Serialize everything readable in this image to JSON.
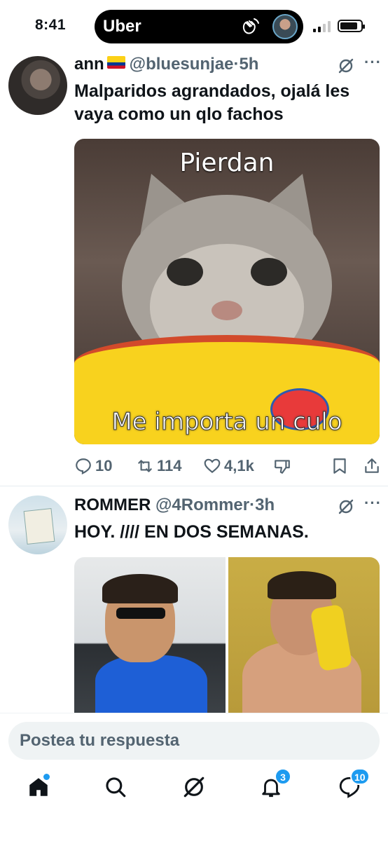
{
  "status_bar": {
    "time": "8:41",
    "island_app": "Uber",
    "icons": [
      "wave-hand-icon",
      "avatar",
      "signal-icon",
      "battery-icon"
    ]
  },
  "tweets": [
    {
      "name": "ann",
      "flag": "colombia-flag-icon",
      "handle": "@bluesunjae",
      "age": "5h",
      "text": "Malparidos agrandados, ojalá les vaya como un qlo fachos",
      "media_caption_top": "Pierdan",
      "media_caption_bottom": "Me importa un culo",
      "replies": "10",
      "retweets": "114",
      "likes": "4,1k"
    },
    {
      "name": "ROMMER",
      "handle": "@4Rommer",
      "age": "3h",
      "text": "HOY. //// EN DOS SEMANAS."
    }
  ],
  "separator": "·",
  "more_label": "···",
  "reply_bar": {
    "placeholder": "Postea tu respuesta"
  },
  "tabbar": {
    "notifications_count": "3",
    "messages_count": "10"
  },
  "colors": {
    "accent": "#1d9bf0",
    "text": "#0f1419",
    "secondary": "#536471"
  }
}
